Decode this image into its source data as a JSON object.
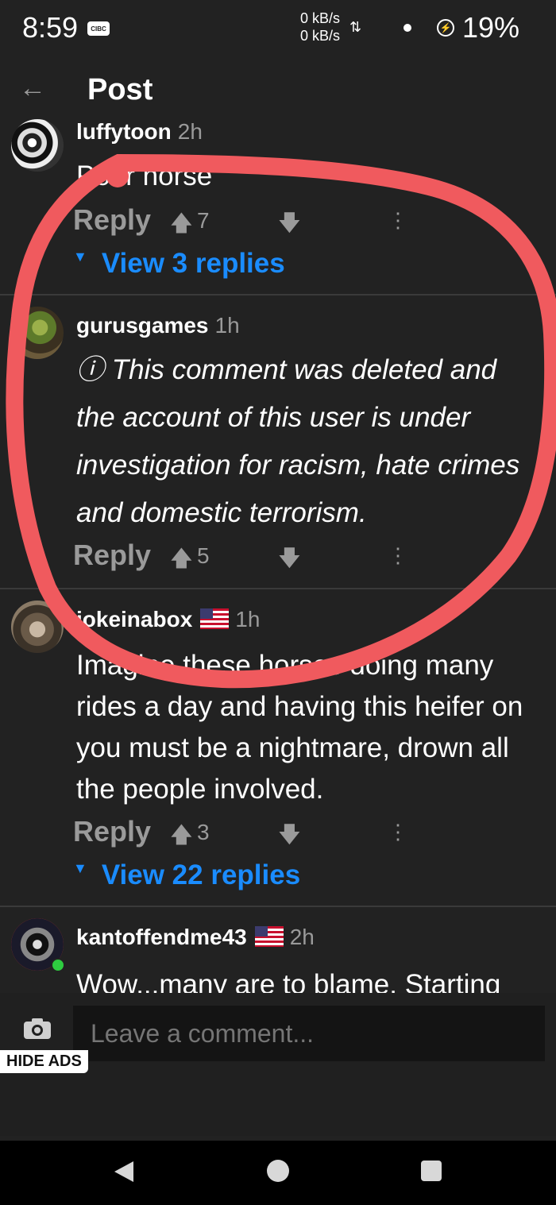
{
  "status_bar": {
    "time": "8:59",
    "carrier_icon": "CIBC",
    "net_up": "0 kB/s",
    "net_down": "0 kB/s",
    "battery": "19%"
  },
  "app_bar": {
    "title": "Post"
  },
  "comments": [
    {
      "username": "luffytoon",
      "time_ago": "2h",
      "text": "Poor horse",
      "reply_label": "Reply",
      "votes": "7",
      "view_replies": "View 3 replies"
    },
    {
      "username": "gurusgames",
      "time_ago": "1h",
      "text": "ⓘ This comment was deleted and the account of this user is under investigation for racism, hate crimes and domestic terrorism.",
      "reply_label": "Reply",
      "votes": "5"
    },
    {
      "username": "jokeinabox",
      "time_ago": "1h",
      "text": "Imagine these horses doing many rides a day and having this heifer on you must be a nightmare, drown all the people involved.",
      "reply_label": "Reply",
      "votes": "3",
      "view_replies": "View 22 replies"
    },
    {
      "username": "kantoffendme43",
      "time_ago": "2h",
      "text": "Wow...many are to blame. Starting"
    }
  ],
  "comment_bar": {
    "placeholder": "Leave a comment...",
    "hide_ads": "HIDE ADS"
  },
  "colors": {
    "background": "#222222",
    "link_blue": "#1a8cff",
    "annotation_red": "#f05a5e"
  }
}
